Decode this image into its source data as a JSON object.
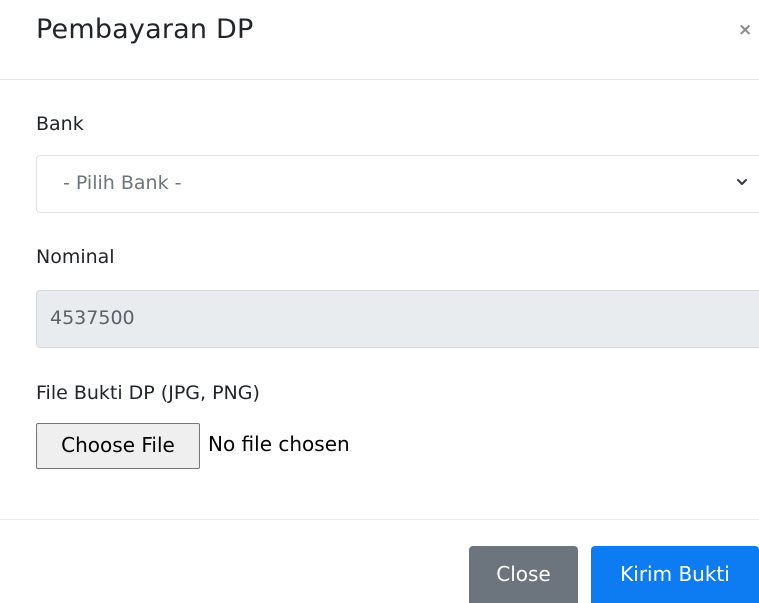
{
  "modal": {
    "title": "Pembayaran DP",
    "close_glyph": "×"
  },
  "form": {
    "bank": {
      "label": "Bank",
      "selected": "- Pilih Bank -"
    },
    "nominal": {
      "label": "Nominal",
      "value": "4537500"
    },
    "file": {
      "label": "File Bukti DP (JPG, PNG)",
      "button_label": "Choose File",
      "status": "No file chosen"
    }
  },
  "footer": {
    "close_label": "Close",
    "submit_label": "Kirim Bukti"
  },
  "colors": {
    "primary": "#0d7cf2",
    "secondary": "#6c757d",
    "readonly_bg": "#e9ecef"
  },
  "icons": {
    "close": "close-icon",
    "select_arrow": "chevron-down-icon"
  }
}
